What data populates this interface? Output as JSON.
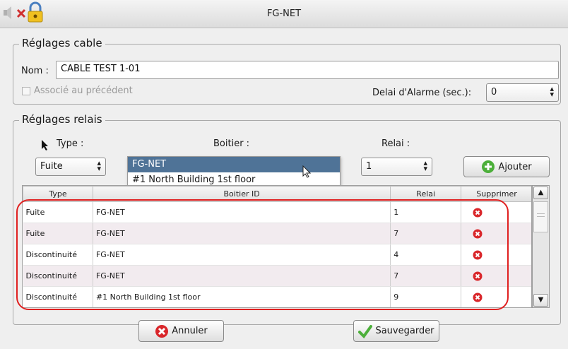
{
  "window": {
    "title": "FG-NET"
  },
  "cable_settings": {
    "legend": "Réglages cable",
    "name_label": "Nom :",
    "name_value": "CABLE TEST 1-01",
    "associated_label": "Associé au précédent",
    "alarm_delay_label": "Delai d'Alarme (sec.):",
    "alarm_delay_value": "0"
  },
  "relay_settings": {
    "legend": "Réglages relais",
    "type_label": "Type :",
    "boitier_label": "Boitier :",
    "relai_label": "Relai :",
    "type_value": "Fuite",
    "relai_value": "1",
    "add_button": "Ajouter",
    "boitier_options": [
      "FG-NET",
      "#1 North Building 1st floor"
    ],
    "boitier_selected": "FG-NET"
  },
  "table": {
    "headers": {
      "type": "Type",
      "boitier": "Boitier ID",
      "relai": "Relai",
      "delete": "Supprimer"
    },
    "rows": [
      {
        "type": "Fuite",
        "boitier": "FG-NET",
        "relai": "1"
      },
      {
        "type": "Fuite",
        "boitier": "FG-NET",
        "relai": "7"
      },
      {
        "type": "Discontinuité",
        "boitier": "FG-NET",
        "relai": "4"
      },
      {
        "type": "Discontinuité",
        "boitier": "FG-NET",
        "relai": "7"
      },
      {
        "type": "Discontinuité",
        "boitier": "#1 North Building 1st floor",
        "relai": "9"
      }
    ]
  },
  "footer": {
    "cancel_button": "Annuler",
    "save_button": "Sauvegarder"
  },
  "colors": {
    "accent": "#4f7397",
    "highlight": "#e02020",
    "delete": "#d9262a",
    "add": "#4caf3a"
  }
}
